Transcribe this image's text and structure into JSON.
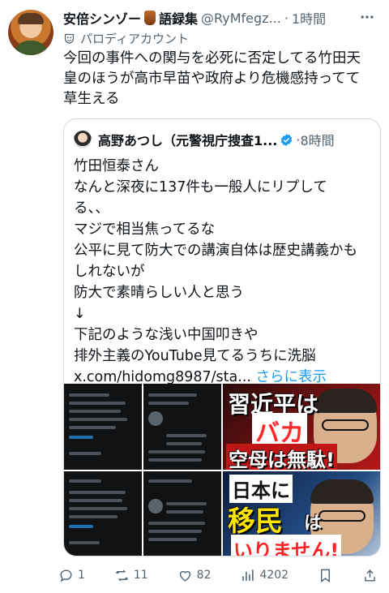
{
  "author": {
    "name": "安倍シンゾー",
    "name_suffix": "語録集",
    "handle": "@RyMfegz...",
    "time": "1時間",
    "label": "パロディアカウント"
  },
  "tweet": {
    "lines": [
      "今回の事件への関与を必死に否定してる竹田天",
      "皇のほうが高市早苗や政府より危機感持ってて",
      "草生える"
    ]
  },
  "quote": {
    "author_name": "高野あつし（元警視庁捜査1...",
    "time": "8時間",
    "lines": [
      "竹田恒泰さん",
      "なんと深夜に137件も一般人にリプしてる、、",
      "る、、",
      "マジで相当焦ってるな",
      "公平に見て防大での講演自体は歴史講義かも",
      "しれないが",
      "防大で素晴らしい人と思う",
      "↓",
      "下記のような浅い中国叩きや",
      "排外主義のYouTube見てるうちに洗脳"
    ],
    "last_line": "x.com/hidomg8987/sta...",
    "show_more": "さらに表示",
    "media": {
      "thumb1_lines": [
        "習近平は",
        "バカ",
        "空母は無駄!"
      ],
      "thumb2_lines": [
        "日本に",
        "移民",
        "は",
        "いりません!"
      ]
    }
  },
  "actions": {
    "reply_count": "1",
    "retweet_count": "11",
    "like_count": "82",
    "view_count": "4202"
  },
  "colors": {
    "accent": "#1d9bf0",
    "verified": "#1d9bf0",
    "muted": "#536471"
  }
}
